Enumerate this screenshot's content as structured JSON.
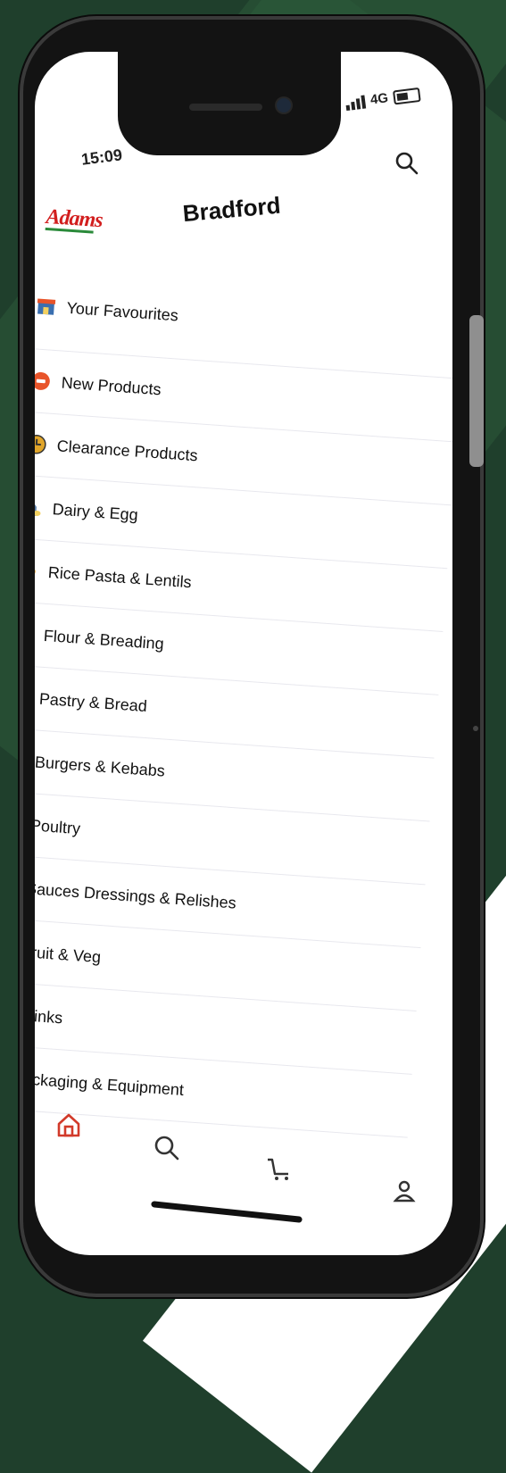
{
  "status": {
    "time": "15:09",
    "network": "4G"
  },
  "header": {
    "title": "Bradford",
    "logo": "Adams",
    "search_icon": "search-icon"
  },
  "menu": [
    {
      "label": "Your Favourites",
      "icon": "store-icon",
      "color": "#3a6fb0"
    },
    {
      "label": "New Products",
      "icon": "new-badge-icon",
      "color": "#e8542a"
    },
    {
      "label": "Clearance Products",
      "icon": "clock-icon",
      "color": "#e0a52a"
    },
    {
      "label": "Dairy & Egg",
      "icon": "milk-icon",
      "color": "#5c7fa8"
    },
    {
      "label": "Rice Pasta & Lentils",
      "icon": "bowl-icon",
      "color": "#f2a23a"
    },
    {
      "label": "Flour & Breading",
      "icon": "flour-bag-icon",
      "color": "#8a5a2a"
    },
    {
      "label": "Pastry & Bread",
      "icon": "pastry-icon",
      "color": "#6a5a3a"
    },
    {
      "label": "Burgers & Kebabs",
      "icon": "burger-icon",
      "color": "#c9692a"
    },
    {
      "label": "Poultry",
      "icon": "chicken-icon",
      "color": "#d23a2a"
    },
    {
      "label": "Sauces Dressings & Relishes",
      "icon": "sauce-bottles-icon",
      "color": "#b8452a"
    },
    {
      "label": "Fruit & Veg",
      "icon": "fruit-basket-icon",
      "color": "#3f9a3f"
    },
    {
      "label": "Drinks",
      "icon": "drink-icon",
      "color": "#d23a4a"
    },
    {
      "label": "Packaging & Equipment",
      "icon": "package-icon",
      "color": "#6b6b6b"
    }
  ],
  "tabbar": {
    "items": [
      {
        "name": "home",
        "icon": "home-icon",
        "active": true
      },
      {
        "name": "search",
        "icon": "search-icon"
      },
      {
        "name": "cart",
        "icon": "cart-icon"
      },
      {
        "name": "account",
        "icon": "user-icon"
      }
    ],
    "active_color": "#d23a2a"
  },
  "colors": {
    "background": "#1f3f2c",
    "accent": "#d23a2a"
  }
}
